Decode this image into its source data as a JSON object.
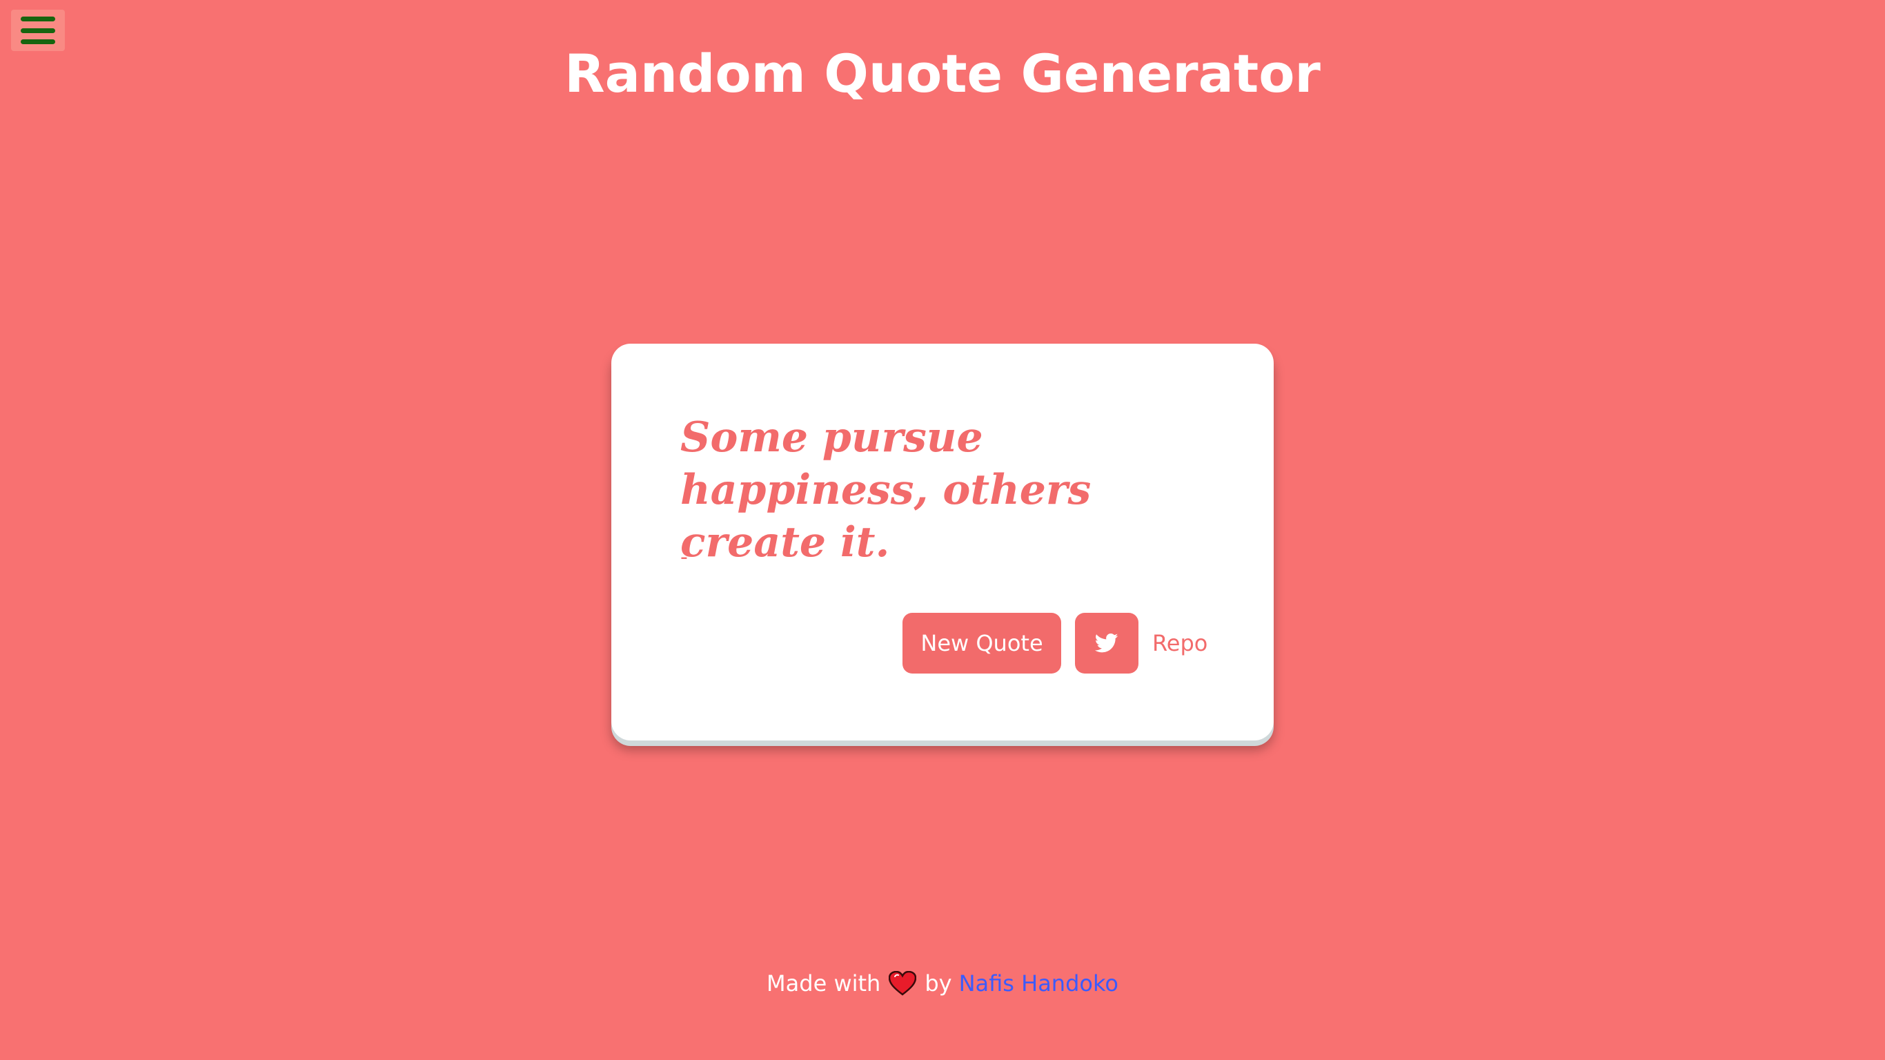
{
  "colors": {
    "background": "#f87171",
    "accent": "#f26b6b",
    "menu_bars": "#16650f",
    "menu_bg": "#f98a84",
    "card": "#ffffff",
    "link_blue": "#3b5bfd",
    "heart": "#e81c2a"
  },
  "header": {
    "title": "Random Quote Generator",
    "menu_icon": "hamburger-menu-icon"
  },
  "quote": {
    "text": "Some pursue happiness, others create it.",
    "author": "-"
  },
  "actions": {
    "new_quote_label": "New Quote",
    "tweet_icon": "twitter-icon",
    "repo_label": "Repo"
  },
  "footer": {
    "made_with": "Made with",
    "heart_icon": "heart-icon",
    "by": "by",
    "author_name": "Nafis Handoko"
  }
}
